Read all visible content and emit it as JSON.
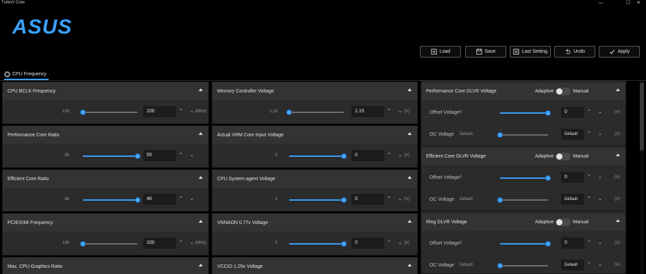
{
  "window": {
    "title": "TurboV Core",
    "minimize_glyph": "—",
    "maximize_glyph": "☐",
    "close_glyph": "✕"
  },
  "brand": {
    "logo_text": "ASUS",
    "color": "#3aa0ff"
  },
  "toolbar": {
    "load": "Load",
    "save": "Save",
    "last_setting": "Last Setting",
    "undo": "Undo",
    "apply": "Apply"
  },
  "tabs": [
    {
      "label": "CPU Frequency",
      "icon": "cpu-icon"
    }
  ],
  "accent": "#3aa0ff",
  "left_column": [
    {
      "title": "CPU BCLK Frequency",
      "min": "100",
      "value": "100",
      "unit": "(MHz)",
      "level": 0.0
    },
    {
      "title": "Performance Core Ratio",
      "min": "55",
      "value": "55",
      "unit": "",
      "level": 1.0
    },
    {
      "title": "Efficient Core Ratio",
      "min": "46",
      "value": "46",
      "unit": "",
      "level": 1.0
    },
    {
      "title": "PCIE/DMI Frequency",
      "min": "100",
      "value": "100",
      "unit": "(MHz)",
      "level": 0.0
    },
    {
      "title": "Max. CPU Graphics Ratio"
    }
  ],
  "middle_column": [
    {
      "title": "Memory Controller Voltage",
      "min": "1.15",
      "value": "1.15",
      "unit": "(V)",
      "level": 0.0
    },
    {
      "title": "Actual VRM Core Input Voltage",
      "min": "0",
      "value": "0",
      "unit": "(V)",
      "level": 1.0
    },
    {
      "title": "CPU System agent Voltage",
      "min": "0",
      "value": "0",
      "unit": "(V)",
      "level": 1.0
    },
    {
      "title": "VNNAON 0.77v Voltage",
      "min": "0",
      "value": "0",
      "unit": "(V)",
      "level": 1.0
    },
    {
      "title": "VCCIO 1.25v Voltage"
    }
  ],
  "right_column": [
    {
      "title": "Performance Core DLVR Voltage",
      "toggle_left": "Adaptive",
      "toggle_right": "Manual",
      "rows": [
        {
          "label": "Offset Voltage",
          "min": "0",
          "value": "0",
          "unit": "(V)",
          "level": 1.0
        },
        {
          "label": "OC Voltage",
          "min": "Default",
          "value": "Default",
          "unit": "(V)",
          "level": 0.0
        }
      ]
    },
    {
      "title": "Efficient Core DLVR Voltage",
      "toggle_left": "Adaptive",
      "toggle_right": "Manual",
      "rows": [
        {
          "label": "Offset Voltage",
          "min": "0",
          "value": "0",
          "unit": "(V)",
          "level": 1.0
        },
        {
          "label": "OC Voltage",
          "min": "Default",
          "value": "Default",
          "unit": "(V)",
          "level": 0.0
        }
      ]
    },
    {
      "title": "Ring DLVR Voltage",
      "toggle_left": "Adaptive",
      "toggle_right": "Manual",
      "rows": [
        {
          "label": "Offset Voltage",
          "min": "0",
          "value": "0",
          "unit": "(V)",
          "level": 1.0
        },
        {
          "label": "OC Voltage",
          "min": "Default",
          "value": "Default",
          "unit": "(V)",
          "level": 0.0
        }
      ]
    }
  ],
  "spin_up": "⌃",
  "spin_down": "⌄"
}
